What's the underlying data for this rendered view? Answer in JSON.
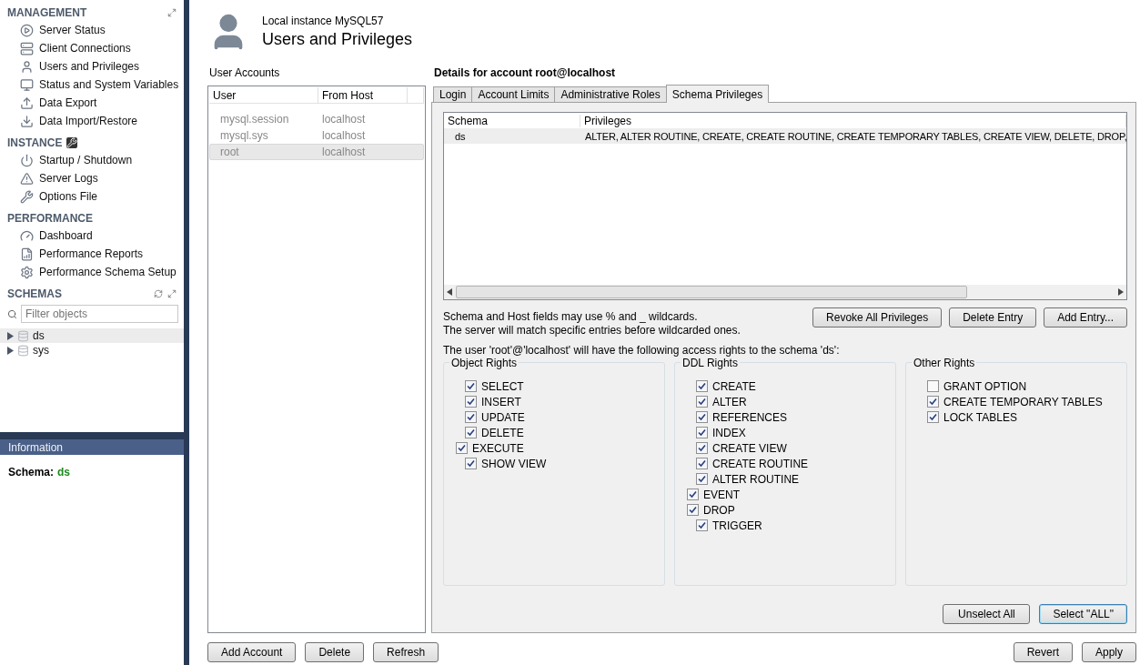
{
  "sidebar": {
    "sections": [
      {
        "title": "MANAGEMENT",
        "items": [
          {
            "label": "Server Status"
          },
          {
            "label": "Client Connections"
          },
          {
            "label": "Users and Privileges"
          },
          {
            "label": "Status and System Variables"
          },
          {
            "label": "Data Export"
          },
          {
            "label": "Data Import/Restore"
          }
        ]
      },
      {
        "title": "INSTANCE",
        "items": [
          {
            "label": "Startup / Shutdown"
          },
          {
            "label": "Server Logs"
          },
          {
            "label": "Options File"
          }
        ]
      },
      {
        "title": "PERFORMANCE",
        "items": [
          {
            "label": "Dashboard"
          },
          {
            "label": "Performance Reports"
          },
          {
            "label": "Performance Schema Setup"
          }
        ]
      }
    ],
    "schemas": {
      "title": "SCHEMAS",
      "filter": {
        "placeholder": "Filter objects"
      },
      "tree": [
        {
          "label": "ds",
          "selected": true
        },
        {
          "label": "sys",
          "selected": false
        }
      ]
    },
    "information": {
      "title": "Information",
      "label": "Schema:",
      "value": "ds"
    }
  },
  "header": {
    "subtitle": "Local instance MySQL57",
    "title": "Users and Privileges"
  },
  "user_accounts": {
    "title": "User Accounts",
    "columns": [
      "User",
      "From Host"
    ],
    "rows": [
      {
        "user": "mysql.session",
        "host": "localhost",
        "selected": false
      },
      {
        "user": "mysql.sys",
        "host": "localhost",
        "selected": false
      },
      {
        "user": "root",
        "host": "localhost",
        "selected": true
      }
    ]
  },
  "account_buttons": [
    "Add Account",
    "Delete",
    "Refresh"
  ],
  "details": {
    "title": "Details for account root@localhost",
    "tabs": [
      {
        "label": "Login",
        "selected": false
      },
      {
        "label": "Account Limits",
        "selected": false
      },
      {
        "label": "Administrative Roles",
        "selected": false
      },
      {
        "label": "Schema Privileges",
        "selected": true
      }
    ],
    "table": {
      "columns": [
        "Schema",
        "Privileges"
      ],
      "rows": [
        {
          "schema": "ds",
          "privileges": "ALTER, ALTER ROUTINE, CREATE, CREATE ROUTINE, CREATE TEMPORARY TABLES, CREATE VIEW, DELETE, DROP,",
          "selected": true
        }
      ]
    },
    "notes": [
      "Schema and Host fields may use % and _ wildcards.",
      "The server will match specific entries before wildcarded ones."
    ],
    "entry_buttons": [
      "Revoke All Privileges",
      "Delete Entry",
      "Add Entry..."
    ],
    "summary": "The user 'root'@'localhost' will have the following access rights to the schema 'ds':",
    "groups": [
      {
        "title": "Object Rights",
        "rights": [
          {
            "label": "SELECT",
            "checked": true,
            "kind": "inner"
          },
          {
            "label": "INSERT",
            "checked": true,
            "kind": "inner"
          },
          {
            "label": "UPDATE",
            "checked": true,
            "kind": "inner"
          },
          {
            "label": "DELETE",
            "checked": true,
            "kind": "inner"
          },
          {
            "label": "EXECUTE",
            "checked": true,
            "kind": "outer"
          },
          {
            "label": "SHOW VIEW",
            "checked": true,
            "kind": "inner"
          }
        ]
      },
      {
        "title": "DDL Rights",
        "rights": [
          {
            "label": "CREATE",
            "checked": true,
            "kind": "inner"
          },
          {
            "label": "ALTER",
            "checked": true,
            "kind": "inner"
          },
          {
            "label": "REFERENCES",
            "checked": true,
            "kind": "inner"
          },
          {
            "label": "INDEX",
            "checked": true,
            "kind": "inner"
          },
          {
            "label": "CREATE VIEW",
            "checked": true,
            "kind": "inner"
          },
          {
            "label": "CREATE ROUTINE",
            "checked": true,
            "kind": "inner"
          },
          {
            "label": "ALTER ROUTINE",
            "checked": true,
            "kind": "inner"
          },
          {
            "label": "EVENT",
            "checked": true,
            "kind": "outer"
          },
          {
            "label": "DROP",
            "checked": true,
            "kind": "outer"
          },
          {
            "label": "TRIGGER",
            "checked": true,
            "kind": "inner"
          }
        ]
      },
      {
        "title": "Other Rights",
        "rights": [
          {
            "label": "GRANT OPTION",
            "checked": false,
            "kind": "inner"
          },
          {
            "label": "CREATE TEMPORARY TABLES",
            "checked": true,
            "kind": "inner"
          },
          {
            "label": "LOCK TABLES",
            "checked": true,
            "kind": "inner"
          }
        ]
      }
    ],
    "select_buttons": [
      {
        "label": "Unselect All",
        "default": false
      },
      {
        "label": "Select \"ALL\"",
        "default": true
      }
    ]
  },
  "footer_buttons": [
    "Revert",
    "Apply"
  ]
}
